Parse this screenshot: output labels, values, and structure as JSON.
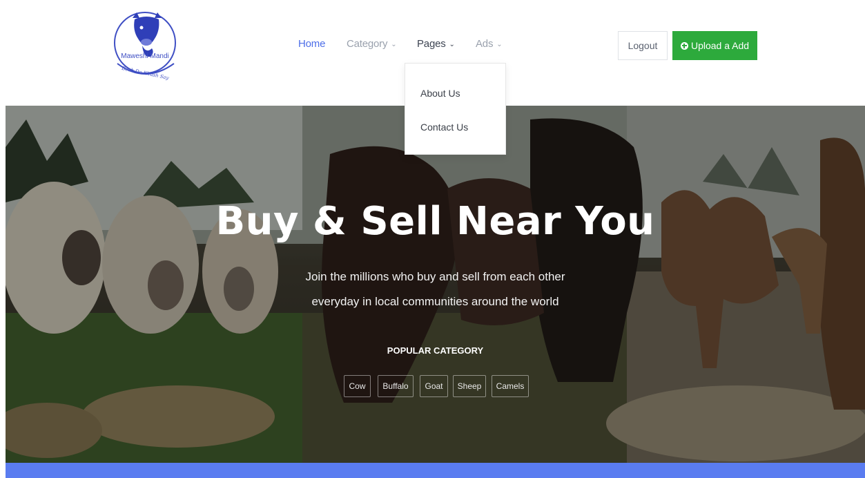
{
  "logo": {
    "brand": "Maweshi Mandi",
    "tagline": "Bech Do Khush Say"
  },
  "nav": {
    "home": "Home",
    "category": "Category",
    "pages": "Pages",
    "ads": "Ads",
    "chevron": "⌄"
  },
  "auth": {
    "logout": "Logout",
    "upload": "Upload a Add"
  },
  "dropdown": {
    "items": [
      "About Us",
      "Contact Us"
    ]
  },
  "hero": {
    "title": "Buy & Sell Near You",
    "subtitle_line1": "Join the millions who buy and sell from each other",
    "subtitle_line2": "everyday in local communities around the world",
    "popular_label": "POPULAR CATEGORY",
    "categories": [
      "Cow",
      "Buffalo",
      "Goat",
      "Sheep",
      "Camels"
    ]
  },
  "colors": {
    "accent": "#4d6ee8",
    "upload": "#2daa3c",
    "bar": "#5a7cf0"
  }
}
